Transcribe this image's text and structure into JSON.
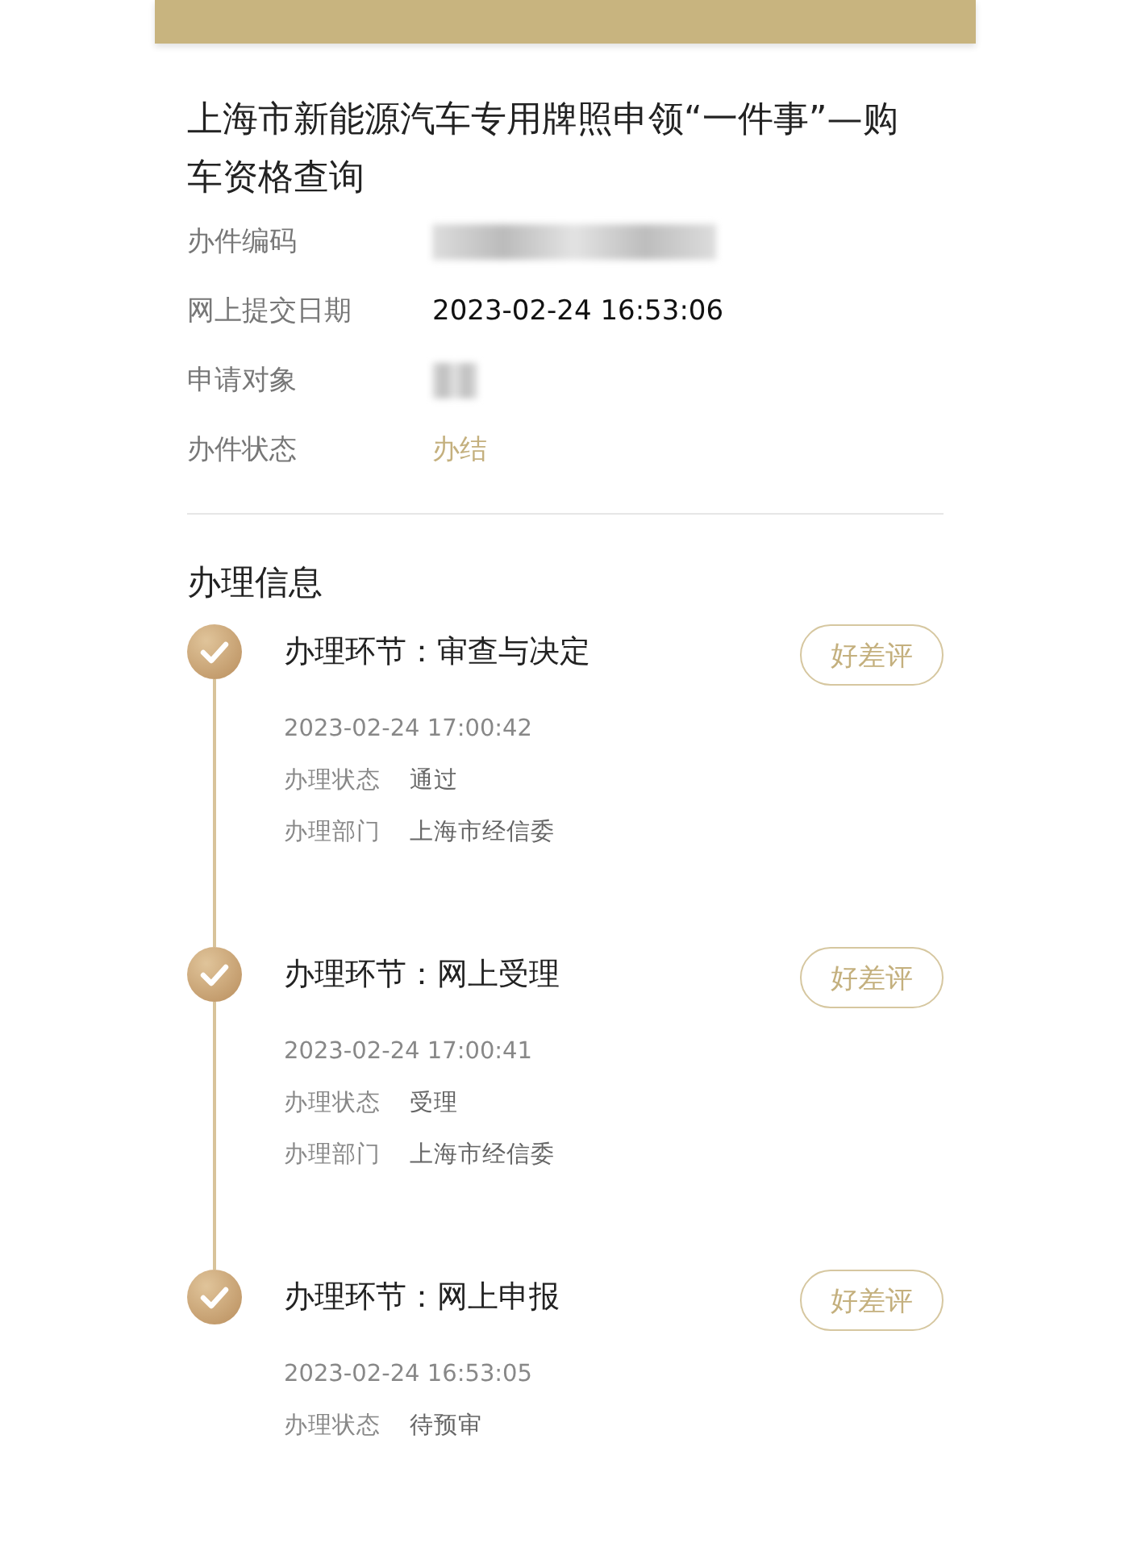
{
  "title": "上海市新能源汽车专用牌照申领“一件事”—购车资格查询",
  "info": [
    {
      "label": "办件编码",
      "kind": "redacted"
    },
    {
      "label": "网上提交日期",
      "kind": "text",
      "value": "2023-02-24 16:53:06"
    },
    {
      "label": "申请对象",
      "kind": "redacted_short"
    },
    {
      "label": "办件状态",
      "kind": "status",
      "value": "办结"
    }
  ],
  "section_title": "办理信息",
  "steps": [
    {
      "title": "办理环节：审查与决定",
      "button": "好差评",
      "time": "2023-02-24 17:00:42",
      "done": true,
      "fields": [
        {
          "label": "办理状态",
          "value": "通过"
        },
        {
          "label": "办理部门",
          "value": "上海市经信委"
        }
      ]
    },
    {
      "title": "办理环节：网上受理",
      "button": "好差评",
      "time": "2023-02-24 17:00:41",
      "done": true,
      "fields": [
        {
          "label": "办理状态",
          "value": "受理"
        },
        {
          "label": "办理部门",
          "value": "上海市经信委"
        }
      ]
    },
    {
      "title": "办理环节：网上申报",
      "button": "好差评",
      "time": "2023-02-24 16:53:05",
      "done": true,
      "fields": [
        {
          "label": "办理状态",
          "value": "待预审"
        }
      ]
    }
  ]
}
